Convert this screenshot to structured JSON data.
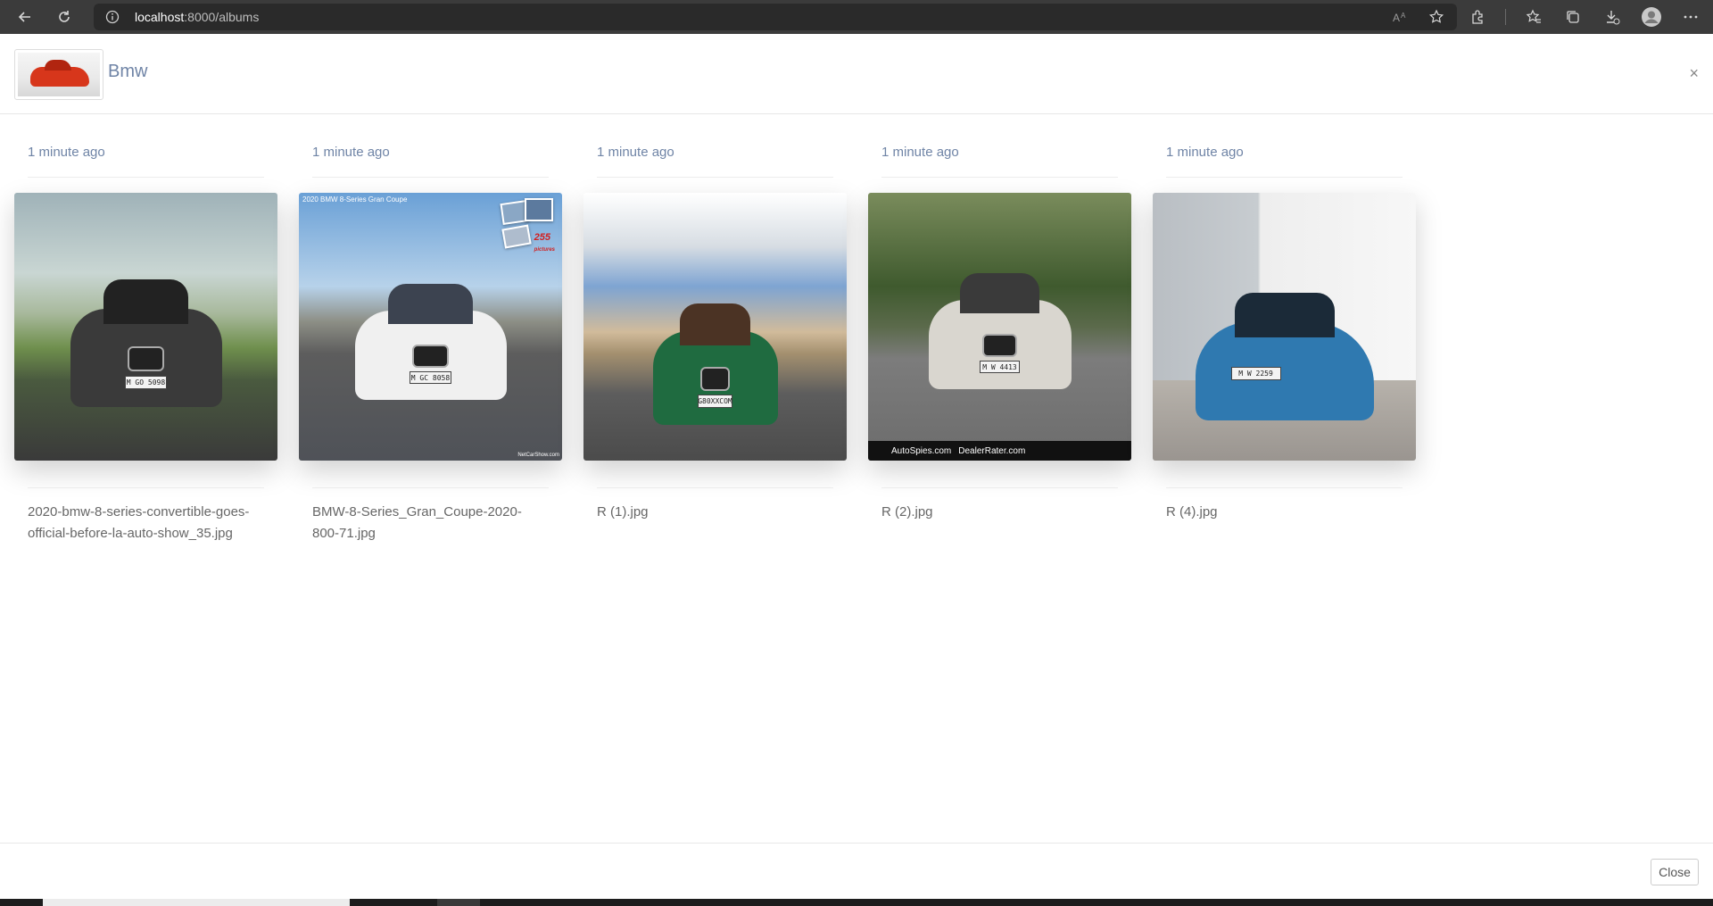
{
  "browser": {
    "url_host": "localhost",
    "url_rest": ":8000/albums"
  },
  "modal": {
    "album_title": "Bmw",
    "close_x": "×",
    "footer_close_label": "Close"
  },
  "photos": [
    {
      "time": "1 minute ago",
      "filename": "2020-bmw-8-series-convertible-goes-official-before-la-auto-show_35.jpg",
      "plate": "M GO 5098"
    },
    {
      "time": "1 minute ago",
      "filename": "BMW-8-Series_Gran_Coupe-2020-800-71.jpg",
      "plate": "M GC 8058",
      "overlay_title": "2020 BMW 8-Series Gran Coupe",
      "overlay_count": "255",
      "overlay_count_label": "pictures",
      "overlay_watermark": "NetCarShow.com"
    },
    {
      "time": "1 minute ago",
      "filename": "R (1).jpg",
      "plate": "G80XXCOM"
    },
    {
      "time": "1 minute ago",
      "filename": "R (2).jpg",
      "plate": "M W 4413",
      "overlay_footer_a": "AutoSpies.com",
      "overlay_footer_b": "DealerRater.com"
    },
    {
      "time": "1 minute ago",
      "filename": "R (4).jpg",
      "plate": "M W 2259"
    }
  ],
  "colors": {
    "accent_text": "#6f84a6",
    "browser_bar": "#3b3b3b"
  },
  "icons": {
    "back": "back-arrow-icon",
    "reload": "reload-icon",
    "info": "info-icon",
    "read_aloud": "read-aloud-icon",
    "favorite": "add-favorite-icon",
    "extensions": "extensions-icon",
    "favorites": "favorites-icon",
    "collections": "collections-icon",
    "downloads": "downloads-icon",
    "profile": "profile-icon",
    "menu": "more-menu-icon"
  }
}
